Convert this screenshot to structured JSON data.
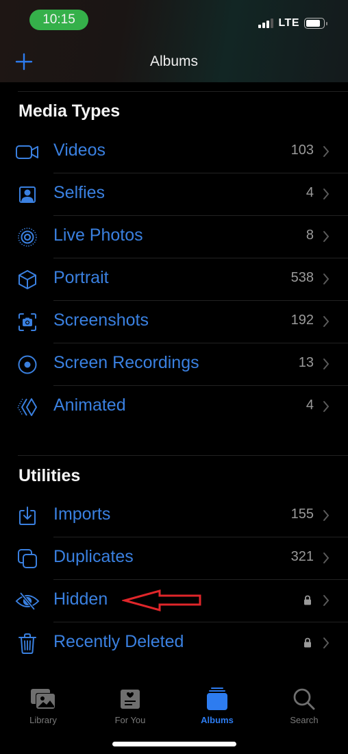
{
  "status_bar": {
    "time": "10:15",
    "network": "LTE",
    "signal_bars_filled": 3,
    "signal_bars_total": 4,
    "battery_level": 0.85
  },
  "nav": {
    "title": "Albums",
    "add_icon": "plus-icon"
  },
  "colors": {
    "accent": "#3a80e0",
    "tab_active": "#2d7cf0",
    "time_pill": "#35b04a",
    "annotation_arrow": "#e0262a"
  },
  "sections": [
    {
      "title": "Media Types",
      "items": [
        {
          "label": "Videos",
          "count": "103",
          "icon": "video-camera-icon"
        },
        {
          "label": "Selfies",
          "count": "4",
          "icon": "person-portrait-icon"
        },
        {
          "label": "Live Photos",
          "count": "8",
          "icon": "live-photo-icon"
        },
        {
          "label": "Portrait",
          "count": "538",
          "icon": "cube-icon"
        },
        {
          "label": "Screenshots",
          "count": "192",
          "icon": "screenshot-camera-icon"
        },
        {
          "label": "Screen Recordings",
          "count": "13",
          "icon": "record-circle-icon"
        },
        {
          "label": "Animated",
          "count": "4",
          "icon": "animated-layers-icon"
        }
      ]
    },
    {
      "title": "Utilities",
      "items": [
        {
          "label": "Imports",
          "count": "155",
          "icon": "import-tray-icon"
        },
        {
          "label": "Duplicates",
          "count": "321",
          "icon": "duplicate-squares-icon"
        },
        {
          "label": "Hidden",
          "count": "",
          "icon": "eye-slash-icon",
          "locked": true
        },
        {
          "label": "Recently Deleted",
          "count": "",
          "icon": "trash-icon",
          "locked": true
        }
      ]
    }
  ],
  "annotation": {
    "type": "arrow",
    "points_to": "Hidden",
    "color": "#e0262a"
  },
  "tabbar": {
    "tabs": [
      {
        "label": "Library",
        "icon": "library-photos-icon",
        "active": false
      },
      {
        "label": "For You",
        "icon": "for-you-icon",
        "active": false
      },
      {
        "label": "Albums",
        "icon": "albums-stack-icon",
        "active": true
      },
      {
        "label": "Search",
        "icon": "search-icon",
        "active": false
      }
    ]
  }
}
